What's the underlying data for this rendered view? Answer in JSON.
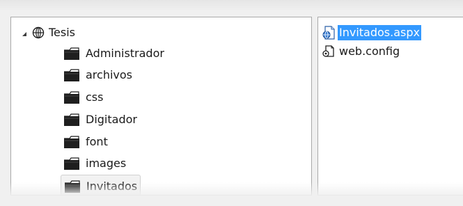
{
  "tree": {
    "root": {
      "label": "Tesis",
      "expander_icon": "triangle-expanded-icon",
      "icon": "globe-icon"
    },
    "folders": [
      {
        "label": "Administrador",
        "icon": "folder-icon"
      },
      {
        "label": "archivos",
        "icon": "folder-icon"
      },
      {
        "label": "css",
        "icon": "folder-icon"
      },
      {
        "label": "Digitador",
        "icon": "folder-icon"
      },
      {
        "label": "font",
        "icon": "folder-icon"
      },
      {
        "label": "images",
        "icon": "folder-icon"
      },
      {
        "label": "Invitados",
        "icon": "folder-icon",
        "selected": true
      }
    ]
  },
  "files": [
    {
      "label": "Invitados.aspx",
      "icon": "aspx-file-icon",
      "selected": true
    },
    {
      "label": "web.config",
      "icon": "config-file-icon",
      "selected": false
    }
  ],
  "colors": {
    "selection": "#3399ff",
    "selected_folder_bg": "#f2f2f2",
    "pane_border": "#a9a9a9"
  }
}
